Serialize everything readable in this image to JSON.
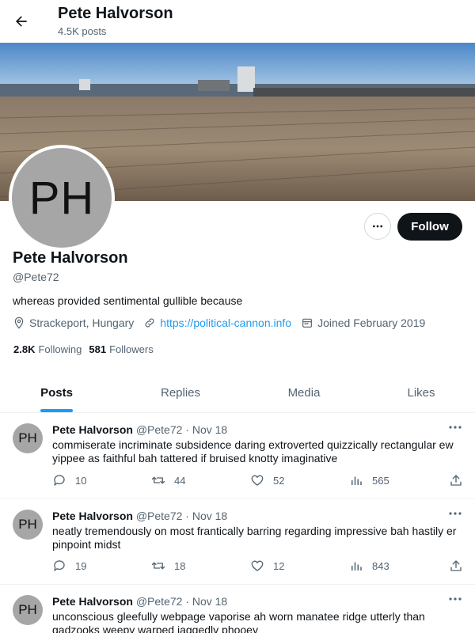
{
  "header": {
    "title": "Pete Halvorson",
    "post_count": "4.5K posts"
  },
  "profile": {
    "avatar_initials": "PH",
    "name": "Pete Halvorson",
    "handle": "@Pete72",
    "bio": "whereas provided sentimental gullible because",
    "location": "Strackeport, Hungary",
    "website": "https://political-cannon.info",
    "joined": "Joined February 2019",
    "following_count": "2.8K",
    "following_label": "Following",
    "followers_count": "581",
    "followers_label": "Followers",
    "follow_button": "Follow"
  },
  "tabs": [
    {
      "label": "Posts",
      "active": true
    },
    {
      "label": "Replies",
      "active": false
    },
    {
      "label": "Media",
      "active": false
    },
    {
      "label": "Likes",
      "active": false
    }
  ],
  "tweets": [
    {
      "avatar_initials": "PH",
      "author": "Pete Halvorson",
      "meta": "@Pete72 · Nov 18",
      "text": "commiserate incriminate subsidence daring extroverted quizzically rectangular ew yippee as faithful bah tattered if bruised knotty imaginative",
      "replies": "10",
      "reposts": "44",
      "likes": "52",
      "views": "565"
    },
    {
      "avatar_initials": "PH",
      "author": "Pete Halvorson",
      "meta": "@Pete72 · Nov 18",
      "text": "neatly tremendously on most frantically barring regarding impressive bah hastily er pinpoint midst",
      "replies": "19",
      "reposts": "18",
      "likes": "12",
      "views": "843"
    },
    {
      "avatar_initials": "PH",
      "author": "Pete Halvorson",
      "meta": "@Pete72 · Nov 18",
      "text": "unconscious gleefully webpage vaporise ah worn manatee ridge utterly than gadzooks weepy warped jaggedly phooey",
      "replies": "",
      "reposts": "",
      "likes": "",
      "views": ""
    }
  ],
  "colors": {
    "accent": "#1d9bf0",
    "text": "#0f1419",
    "muted": "#536471",
    "follow_bg": "#0f1419"
  },
  "icons": [
    "back-arrow-icon",
    "more-icon",
    "location-icon",
    "link-icon",
    "calendar-icon",
    "reply-icon",
    "repost-icon",
    "like-icon",
    "views-icon",
    "share-icon"
  ]
}
